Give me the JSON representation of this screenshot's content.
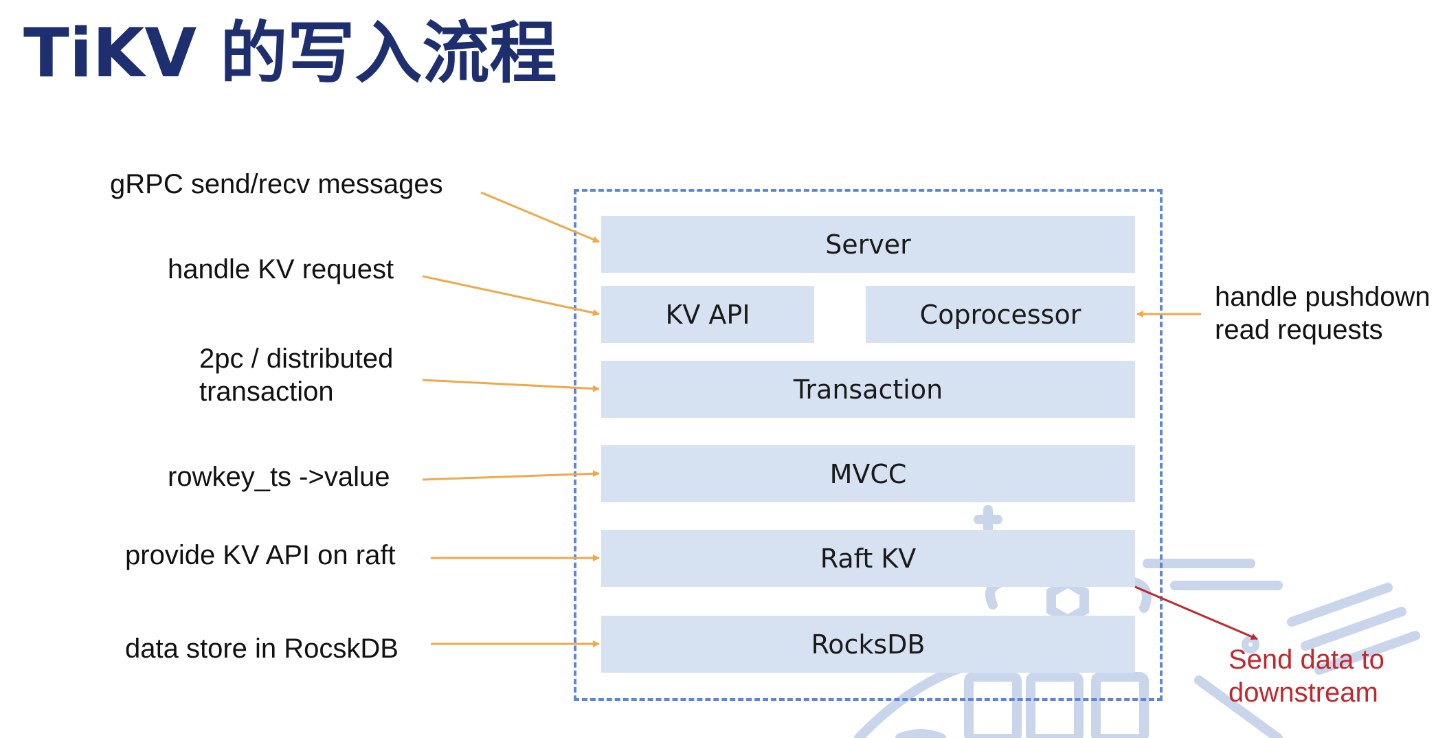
{
  "title": "TiKV 的写入流程",
  "layers": {
    "server": "Server",
    "kv_api": "KV API",
    "coprocessor": "Coprocessor",
    "transaction": "Transaction",
    "mvcc": "MVCC",
    "raft_kv": "Raft KV",
    "rocksdb": "RocksDB"
  },
  "notes": {
    "grpc": "gRPC send/recv messages",
    "handle_kv": "handle KV request",
    "twopc_line1": "2pc / distributed",
    "twopc_line2": "transaction",
    "rowkey": "rowkey_ts ->value",
    "provide_kv": "provide KV API on raft",
    "data_store": "data store in RocskDB",
    "pushdown_line1": "handle pushdown",
    "pushdown_line2": "read requests",
    "send_line1": "Send data to",
    "send_line2": "downstream"
  },
  "colors": {
    "title": "#1d2f6f",
    "layer_fill": "#d6e2f1",
    "frame_border": "#5b86d9",
    "arrow_orange": "#f0a848",
    "arrow_red": "#c0282d",
    "watermark": "#c9d5ea"
  }
}
